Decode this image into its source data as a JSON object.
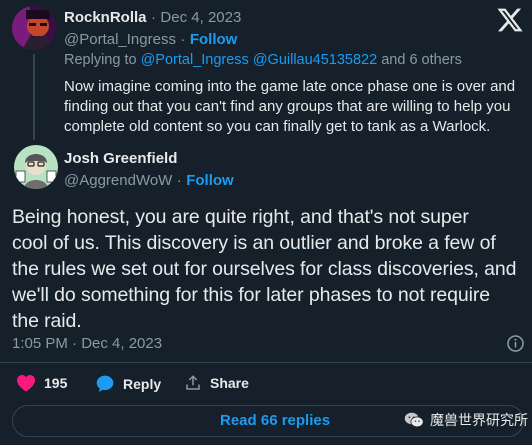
{
  "reply_tweet": {
    "display_name": "RocknRolla",
    "separator": "·",
    "date": "Dec 4, 2023",
    "handle": "@Portal_Ingress",
    "follow_label": "Follow",
    "replying_prefix": "Replying to",
    "replying_mentions": "@Portal_Ingress @Guillau45135822",
    "replying_suffix": "and 6 others",
    "text_lines": [
      "Now imagine coming into the game late once phase one is over and",
      "finding out that you can't find any groups that are willing to help you",
      "complete old content so you can finally get to tank as a Warlock."
    ]
  },
  "main_tweet": {
    "display_name": "Josh Greenfield",
    "handle": "@AggrendWoW",
    "separator": "·",
    "follow_label": "Follow",
    "text_lines": [
      "Being honest, you are quite right, and that's not super",
      "cool of us. This discovery is an outlier and broke a few of",
      "the rules we set out for ourselves for class discoveries, and",
      "we'll do something for this for later phases to not require",
      "the raid."
    ],
    "timestamp": "1:05 PM · Dec 4, 2023"
  },
  "actions": {
    "like_count": "195",
    "reply_label": "Reply",
    "share_label": "Share"
  },
  "read_replies_label": "Read 66 replies",
  "watermark_text": "魔兽世界研究所",
  "icons": {
    "logo": "x-logo-icon",
    "info": "info-icon",
    "like": "heart-icon",
    "reply": "speech-bubble-icon",
    "share": "share-icon",
    "watermark": "wechat-icon"
  },
  "colors": {
    "background": "#15202b",
    "text": "#e7e9ea",
    "muted": "#8b98a5",
    "accent": "#1d9bf0",
    "like": "#f91880",
    "border": "#38444d"
  }
}
